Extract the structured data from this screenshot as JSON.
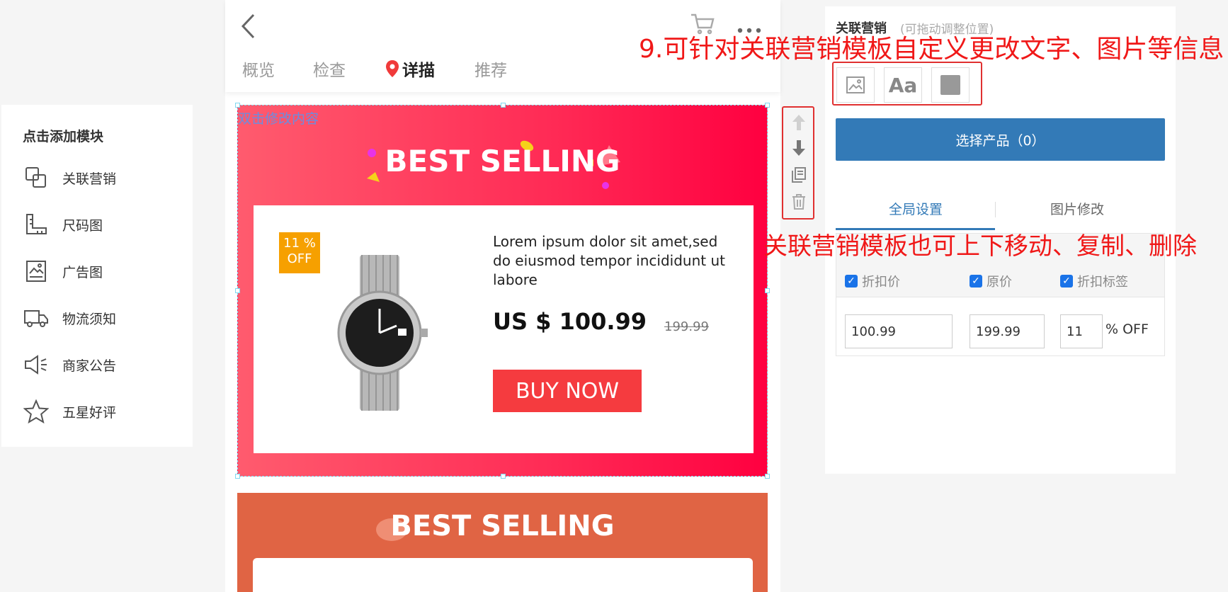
{
  "left_panel": {
    "title": "点击添加模块",
    "items": [
      {
        "label": "关联营销",
        "icon": "link-squares-icon"
      },
      {
        "label": "尺码图",
        "icon": "ruler-icon"
      },
      {
        "label": "广告图",
        "icon": "image-icon"
      },
      {
        "label": "物流须知",
        "icon": "truck-icon"
      },
      {
        "label": "商家公告",
        "icon": "megaphone-icon"
      },
      {
        "label": "五星好评",
        "icon": "star-icon"
      }
    ]
  },
  "preview": {
    "tabs": [
      {
        "label": "概览"
      },
      {
        "label": "检查"
      },
      {
        "label": "详描",
        "active": true
      },
      {
        "label": "推荐"
      }
    ],
    "module1": {
      "hint": "双击修改内容",
      "title": "BEST SELLING",
      "badge_line1": "11 %",
      "badge_line2": "OFF",
      "description": "Lorem ipsum dolor sit amet,sed do eiusmod tempor incididunt ut labore",
      "price": "US $ 100.99",
      "old_price": "199.99",
      "buy_label": "BUY NOW"
    },
    "module2": {
      "title": "BEST SELLING"
    }
  },
  "right_panel": {
    "title": "关联营销",
    "subtitle": "(可拖动调整位置)",
    "select_button": "选择产品（0）",
    "tabs": [
      {
        "label": "全局设置",
        "active": true
      },
      {
        "label": "图片修改"
      }
    ],
    "checkboxes": [
      {
        "label": "折扣价",
        "checked": true
      },
      {
        "label": "原价",
        "checked": true
      },
      {
        "label": "折扣标签",
        "checked": true
      }
    ],
    "inputs": {
      "discount_price": "100.99",
      "original_price": "199.99",
      "discount_percent": "11",
      "percent_suffix": "% OFF"
    }
  },
  "annotations": {
    "top": "9.可针对关联营销模板自定义更改文字、图片等信息",
    "middle": "关联营销模板也可上下移动、复制、删除"
  },
  "colors": {
    "accent_blue": "#337ab7",
    "annotation_red": "#f01818",
    "module1_gradient_end": "#ff0040",
    "module2_bg": "#e06444",
    "buy_button": "#f53b3f",
    "badge": "#f6a000"
  }
}
